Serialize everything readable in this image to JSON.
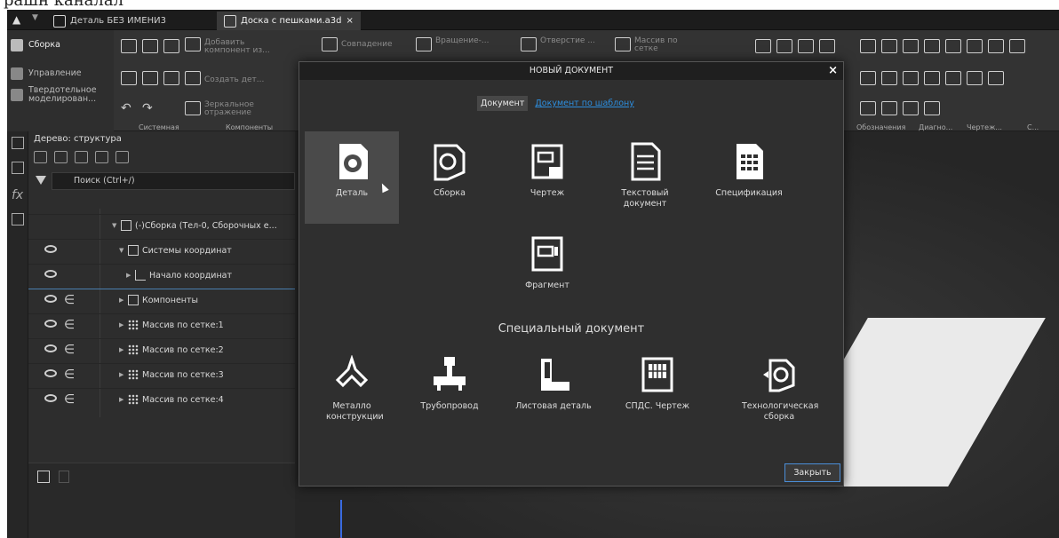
{
  "top_cut_text": "рашн каналал",
  "tabs": [
    {
      "label": "Деталь БЕЗ ИМЕНИ3"
    },
    {
      "label": "Доска с пешками.a3d",
      "close": "×"
    }
  ],
  "ribbon": {
    "left_items": [
      {
        "label": "Сборка"
      },
      {
        "label": "Управление"
      },
      {
        "label": "Твердотельное моделирован..."
      }
    ],
    "texts": {
      "add_component": "Добавить компонент из...",
      "create_detail": "Создать дет...",
      "mirror": "Зеркальное отражение",
      "match": "Совпадение",
      "rotation": "Вращение-...",
      "hole": "Отверстие ...",
      "array": "Массив по сетке"
    },
    "sections": {
      "system": "Системная",
      "components": "Компоненты",
      "designations": "Обозначения",
      "diagnostics": "Диагно...",
      "drawing": "Чертеж...",
      "c": "С..."
    }
  },
  "tree": {
    "title": "Дерево: структура",
    "search_placeholder": "Поиск (Ctrl+/)",
    "rows": [
      {
        "label": "(-)Сборка (Тел-0, Сборочных е..."
      },
      {
        "label": "Системы координат"
      },
      {
        "label": "Начало координат"
      },
      {
        "label": "Компоненты"
      },
      {
        "label": "Массив по сетке:1"
      },
      {
        "label": "Массив по сетке:2"
      },
      {
        "label": "Массив по сетке:3"
      },
      {
        "label": "Массив по сетке:4"
      }
    ]
  },
  "modal": {
    "title": "НОВЫЙ ДОКУМЕНТ",
    "close_x": "×",
    "tab_document": "Документ",
    "tab_template": "Документ по шаблону",
    "tiles": [
      {
        "label": "Деталь",
        "icon": "detail-icon"
      },
      {
        "label": "Сборка",
        "icon": "assembly-icon"
      },
      {
        "label": "Чертеж",
        "icon": "drawing-icon"
      },
      {
        "label": "Текстовый документ",
        "icon": "text-document-icon"
      },
      {
        "label": "Спецификация",
        "icon": "specification-icon"
      },
      {
        "label": "Фрагмент",
        "icon": "fragment-icon"
      }
    ],
    "special_heading": "Специальный документ",
    "special_tiles": [
      {
        "label": "Металло конструкции",
        "icon": "metal-structures-icon"
      },
      {
        "label": "Трубопровод",
        "icon": "pipeline-icon"
      },
      {
        "label": "Листовая деталь",
        "icon": "sheet-part-icon"
      },
      {
        "label": "СПДС. Чертеж",
        "icon": "spds-drawing-icon"
      },
      {
        "label": "Технологическая сборка",
        "icon": "tech-assembly-icon"
      }
    ],
    "close_button": "Закрыть"
  }
}
